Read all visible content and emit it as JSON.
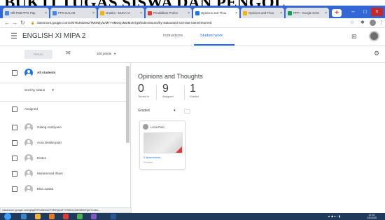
{
  "heading": "BUKTI TUGAS SISWA DAN PENGOL",
  "browser": {
    "tabs": [
      {
        "label": "Ofli PKB PPG Pap",
        "color": "#4285f4",
        "active": false
      },
      {
        "label": "PPG DALAB",
        "color": "#4285f4",
        "active": false
      },
      {
        "label": "Grades - DUKA VI",
        "color": "#f4b400",
        "active": false
      },
      {
        "label": "Pendidikan Profes",
        "color": "#e53935",
        "active": false
      },
      {
        "label": "Opinions and Thou",
        "color": "#1a73e8",
        "active": true
      },
      {
        "label": "Opinions and Thou",
        "color": "#f4b400",
        "active": false
      },
      {
        "label": "PPP - Google Drive",
        "color": "#0f9d58",
        "active": false
      }
    ],
    "new_tab": "+",
    "address": "classroom.google.com/c/MTE4NDIwOTM0NjIy/a/MTY0MDQ1MDMzNTg0/submissions/by-status/and-sort-last-name/returned",
    "status_url": "classroom.google.com/g/tg/MTE4NDIwOTM0NjIy/MTY0MDQ1MDMzNTg0/Yxubu..."
  },
  "app": {
    "class_name": "ENGLISH XI MIPA 2",
    "tabs": [
      "Instructions",
      "Student work"
    ],
    "active_tab": "Student work"
  },
  "toolbar": {
    "return_label": "Return",
    "points": "100 points",
    "points_caret": "▾"
  },
  "sidebar": {
    "all_students": "All students",
    "sort_label": "Sort by status",
    "sort_caret": "▾",
    "section": "Assigned",
    "students": [
      "Gilang Andriyano",
      "Aura Desilia putri",
      "Dintex",
      "Muhammad Ilham",
      "Elsa Juwita"
    ]
  },
  "assignment": {
    "title": "Opinions and Thoughts",
    "stats": [
      {
        "num": "0",
        "label": "Turned in"
      },
      {
        "num": "9",
        "label": "Assigned"
      },
      {
        "num": "1",
        "label": "Graded"
      }
    ],
    "filter": "Graded",
    "filter_caret": "▾"
  },
  "card": {
    "name": "Lecia Putri",
    "attachments": "2 attachments",
    "state": "Graded"
  },
  "taskbar": {
    "time": "17:02",
    "date": "13/10/20"
  },
  "colors": {
    "accent": "#1a73e8",
    "tabbar": "#3367d6",
    "taskbar": "#1f3a5a"
  }
}
